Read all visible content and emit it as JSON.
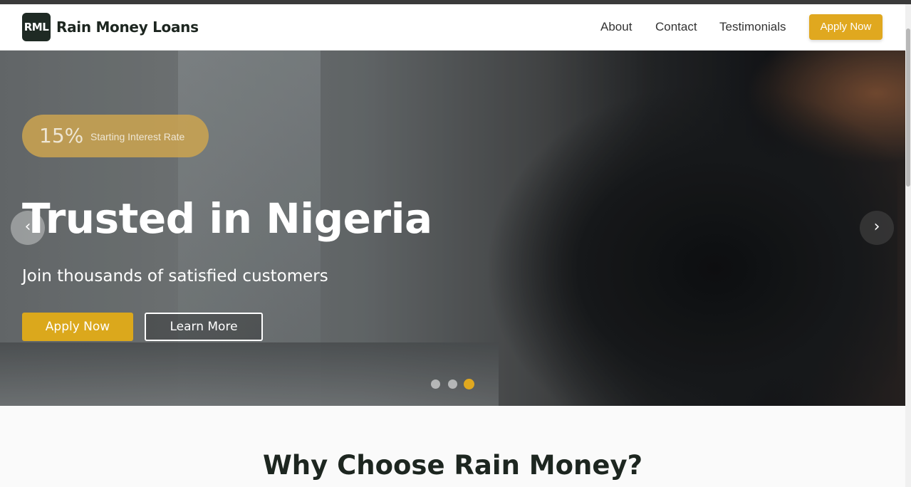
{
  "brand": {
    "logo_text": "RML",
    "name": "Rain Money Loans"
  },
  "nav": {
    "links": [
      "About",
      "Contact",
      "Testimonials"
    ],
    "apply_label": "Apply Now",
    "accent_color": "#e0a81f"
  },
  "hero": {
    "badge": {
      "rate": "15%",
      "label": "Starting Interest Rate"
    },
    "title": "Trusted in Nigeria",
    "subtitle": "Join thousands of satisfied customers",
    "primary_button": "Apply Now",
    "secondary_button": "Learn More",
    "prev_icon": "‹",
    "next_icon": "›",
    "slides": {
      "count": 3,
      "active_index": 2
    }
  },
  "section": {
    "title": "Why Choose Rain Money?"
  }
}
